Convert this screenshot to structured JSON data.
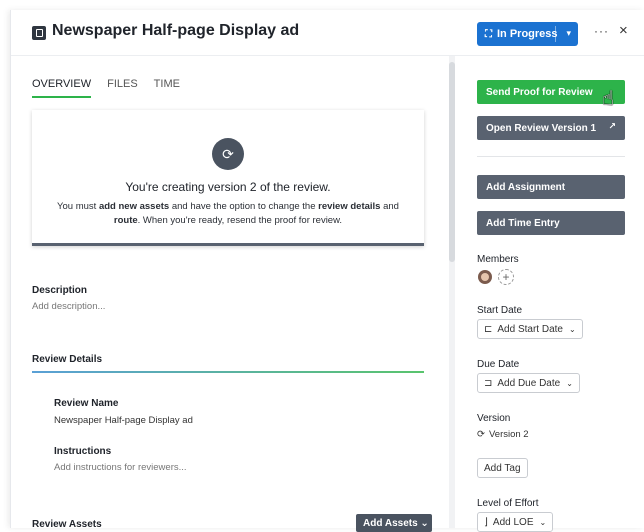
{
  "header": {
    "title": "Newspaper Half-page Display ad",
    "status_label": "In Progress",
    "more": "···",
    "close": "×"
  },
  "tabs": [
    "OVERVIEW",
    "FILES",
    "TIME"
  ],
  "notice": {
    "heading": "You're creating version 2 of the review.",
    "line_pre": "You must ",
    "line_b1": "add new assets",
    "line_mid": " and have the option to change the ",
    "line_b2": "review details",
    "line_and": " and ",
    "line_b3": "route",
    "line_post": ". When you're ready, resend the proof for review."
  },
  "description": {
    "label": "Description",
    "placeholder": "Add description..."
  },
  "review_details": {
    "section": "Review Details",
    "name_label": "Review Name",
    "name_value": "Newspaper Half-page Display ad",
    "instructions_label": "Instructions",
    "instructions_placeholder": "Add instructions for reviewers..."
  },
  "review_assets": {
    "label": "Review Assets",
    "button": "Add Assets ⌄"
  },
  "sidebar": {
    "send_proof": "Send Proof for Review",
    "open_review": "Open Review Version 1",
    "add_assignment": "Add Assignment",
    "add_time": "Add Time Entry",
    "members_label": "Members",
    "start_label": "Start Date",
    "start_btn": "Add Start Date",
    "due_label": "Due Date",
    "due_btn": "Add Due Date",
    "version_label": "Version",
    "version_value": "Version 2",
    "add_tag": "Add Tag",
    "loe_label": "Level of Effort",
    "loe_btn": "Add LOE"
  },
  "colors": {
    "accent_green": "#2db34a",
    "status_blue": "#1b72d1",
    "slate": "#596270"
  }
}
